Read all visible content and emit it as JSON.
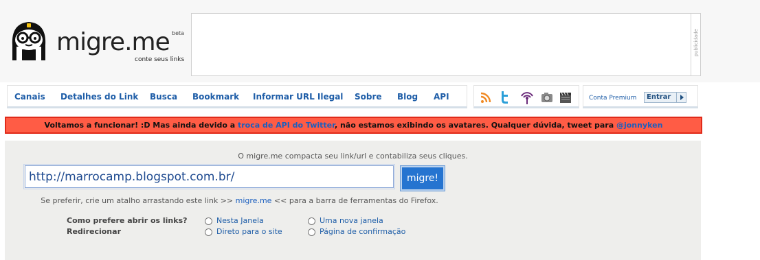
{
  "brand": {
    "name": "migre.me",
    "beta": "beta",
    "tagline": "conte seus links"
  },
  "ad": {
    "label": "publicidade"
  },
  "nav": {
    "items": [
      "Canais",
      "Detalhes do Link",
      "Busca",
      "Bookmark",
      "Informar URL Ilegal",
      "Sobre",
      "Blog",
      "API"
    ],
    "icons": [
      "rss-icon",
      "twitter-icon",
      "podcast-icon",
      "camera-icon",
      "clapperboard-icon"
    ]
  },
  "premium": {
    "label": "Conta Premium",
    "button": "Entrar"
  },
  "alert": {
    "text_before": "Voltamos a funcionar! :D Mas ainda devido a ",
    "link1": "troca de API do Twitter",
    "text_middle": ", não estamos exibindo os avatares. Qualquer dúvida, tweet para ",
    "link2": "@jonnyken"
  },
  "form": {
    "intro": "O migre.me compacta seu link/url e contabiliza seus cliques.",
    "url_value": "http://marrocamp.blogspot.com.br/",
    "submit": "migre!",
    "bookmark_before": "Se preferir, crie um atalho arrastando este link >> ",
    "bookmark_link": "migre.me",
    "bookmark_after": " << para a barra de ferramentas do Firefox."
  },
  "options": {
    "open_label": "Como prefere abrir os links?",
    "open_choices": [
      "Nesta Janela",
      "Uma nova janela"
    ],
    "redirect_label": "Redirecionar",
    "redirect_choices": [
      "Direto para o site",
      "Página de confirmação"
    ]
  },
  "colors": {
    "link": "#1f5ea8",
    "alert_bg": "#ff5c45",
    "alert_border": "#e02a1a",
    "button": "#2574d0",
    "rss": "#f08a24",
    "twitter": "#2b9fd8",
    "podcast": "#6a2a7a"
  }
}
